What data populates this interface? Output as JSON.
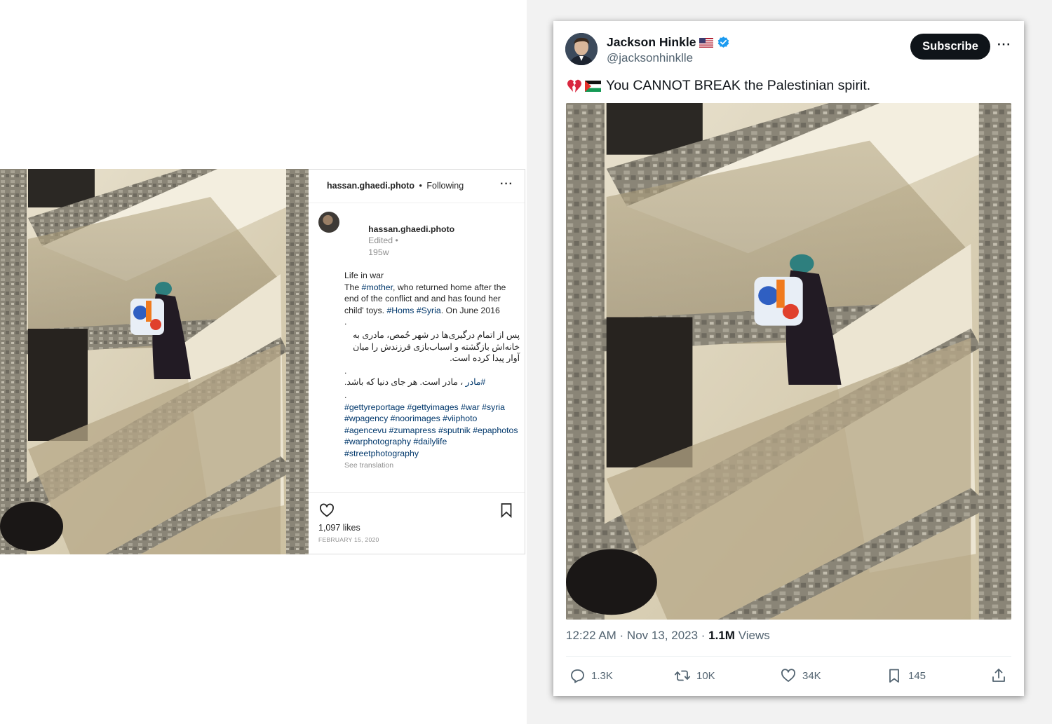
{
  "instagram": {
    "header": {
      "username": "hassan.ghaedi.photo",
      "separator": "•",
      "following": "Following"
    },
    "caption": {
      "username": "hassan.ghaedi.photo",
      "edited": "Edited •",
      "age": "195w",
      "title": "Life in war",
      "p1_pre": "The ",
      "p1_tag": "#mother",
      "p1_mid": ", who returned home after the end of the conflict and and has found her child' toys. ",
      "p1_tag2": "#Homs",
      "p1_sp": " ",
      "p1_tag3": "#Syria",
      "p1_post": ". On June 2016",
      "dot1": ".",
      "persian1": "پس از اتمام درگیری‌ها در شهر حُمص، مادری به خانه‌اش بازگشته و اسباب‌بازی فرزندش را میان آوار پیدا کرده است.",
      "dot2": ".",
      "persian2_tag": "#مادر",
      "persian2": " ، مادر است. هر جای دنیا که باشد.",
      "dot3": ".",
      "hashtags": "#gettyreportage #gettyimages #war #syria #wpagency #noorimages #viiphoto #agencevu #zumapress #sputnik #epaphotos #warphotography #dailylife #streetphotography",
      "see_translation": "See translation"
    },
    "likes": "1,097 likes",
    "date": "FEBRUARY 15, 2020"
  },
  "tweet": {
    "name": "Jackson Hinkle",
    "handle": "@jacksonhinklle",
    "subscribe": "Subscribe",
    "text": "You CANNOT BREAK the Palestinian spirit.",
    "time": "12:22 AM · Nov 13, 2023 · ",
    "views_count": "1.1M",
    "views_label": " Views",
    "replies": "1.3K",
    "retweets": "10K",
    "likes": "34K",
    "bookmarks": "145"
  },
  "icons": [
    "more-icon",
    "heart-icon",
    "bookmark-icon",
    "verified-icon",
    "us-flag-icon",
    "broken-heart-icon",
    "palestine-flag-icon",
    "reply-icon",
    "retweet-icon",
    "share-icon"
  ]
}
